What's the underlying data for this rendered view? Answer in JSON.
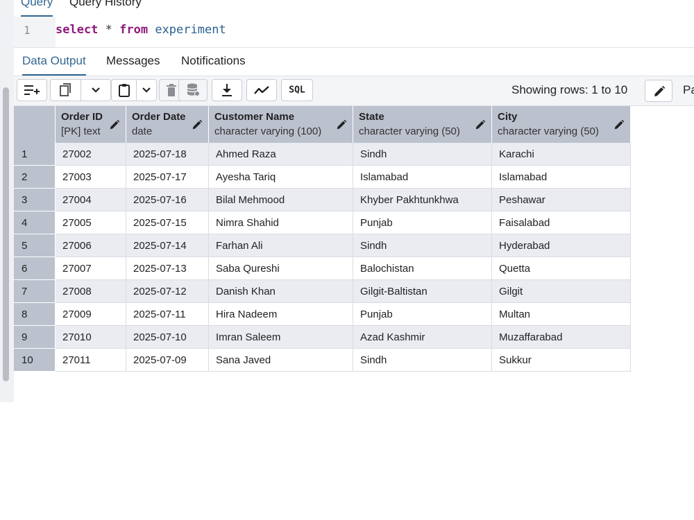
{
  "editor_tabs": [
    {
      "label": "Query"
    },
    {
      "label": "Query History"
    }
  ],
  "editor": {
    "line_number": "1",
    "tokens": {
      "select": "select",
      "star": " * ",
      "from": "from",
      "table": " experiment"
    }
  },
  "result_tabs": [
    {
      "label": "Data Output"
    },
    {
      "label": "Messages"
    },
    {
      "label": "Notifications"
    }
  ],
  "toolbar": {
    "buttons": [
      "add-row-icon",
      "copy-icon",
      "chevron-down-icon",
      "paste-icon",
      "chevron-down-icon",
      "delete-icon",
      "save-data-icon",
      "download-icon",
      "graph-icon",
      "sql-button"
    ],
    "sql_label": "SQL",
    "rows_info": "Showing rows: 1 to 10",
    "trailing_text": "Pa"
  },
  "grid": {
    "columns": [
      {
        "name": "Order ID",
        "type": "[PK] text"
      },
      {
        "name": "Order Date",
        "type": "date"
      },
      {
        "name": "Customer Name",
        "type": "character varying (100)"
      },
      {
        "name": "State",
        "type": "character varying (50)"
      },
      {
        "name": "City",
        "type": "character varying (50)"
      }
    ],
    "rows": [
      {
        "n": "1",
        "cells": [
          "27002",
          "2025-07-18",
          "Ahmed Raza",
          "Sindh",
          "Karachi"
        ]
      },
      {
        "n": "2",
        "cells": [
          "27003",
          "2025-07-17",
          "Ayesha Tariq",
          "Islamabad",
          "Islamabad"
        ]
      },
      {
        "n": "3",
        "cells": [
          "27004",
          "2025-07-16",
          "Bilal Mehmood",
          "Khyber Pakhtunkhwa",
          "Peshawar"
        ]
      },
      {
        "n": "4",
        "cells": [
          "27005",
          "2025-07-15",
          "Nimra Shahid",
          "Punjab",
          "Faisalabad"
        ]
      },
      {
        "n": "5",
        "cells": [
          "27006",
          "2025-07-14",
          "Farhan Ali",
          "Sindh",
          "Hyderabad"
        ]
      },
      {
        "n": "6",
        "cells": [
          "27007",
          "2025-07-13",
          "Saba Qureshi",
          "Balochistan",
          "Quetta"
        ]
      },
      {
        "n": "7",
        "cells": [
          "27008",
          "2025-07-12",
          "Danish Khan",
          "Gilgit-Baltistan",
          "Gilgit"
        ]
      },
      {
        "n": "8",
        "cells": [
          "27009",
          "2025-07-11",
          "Hira Nadeem",
          "Punjab",
          "Multan"
        ]
      },
      {
        "n": "9",
        "cells": [
          "27010",
          "2025-07-10",
          "Imran Saleem",
          "Azad Kashmir",
          "Muzaffarabad"
        ]
      },
      {
        "n": "10",
        "cells": [
          "27011",
          "2025-07-09",
          "Sana Javed",
          "Sindh",
          "Sukkur"
        ]
      }
    ]
  },
  "colors": {
    "accent": "#326690",
    "keyword": "#8f1a7a",
    "identifier": "#2a5f8f",
    "header_bg": "#bcc1ce",
    "stripe_bg": "#eaecf1"
  }
}
